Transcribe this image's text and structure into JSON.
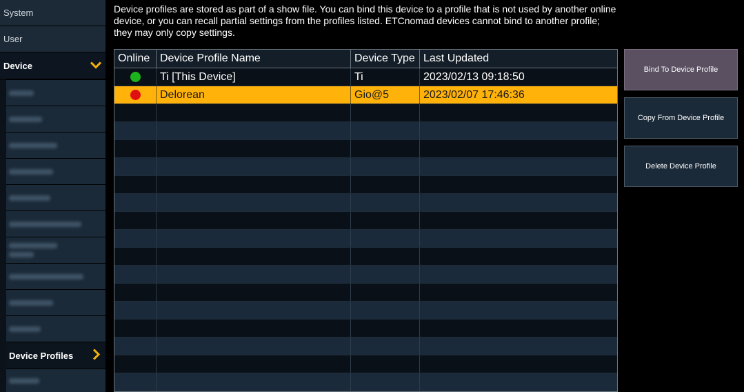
{
  "sidebar": {
    "top_items": [
      {
        "label": "System"
      },
      {
        "label": "User"
      },
      {
        "label": "Device",
        "selected": true
      }
    ],
    "sub_items": [
      {
        "label": ""
      },
      {
        "label": ""
      },
      {
        "label": ""
      },
      {
        "label": ""
      },
      {
        "label": ""
      },
      {
        "label": ""
      },
      {
        "label": ""
      },
      {
        "label": ""
      },
      {
        "label": ""
      },
      {
        "label": ""
      },
      {
        "label": "Device Profiles",
        "selected": true
      },
      {
        "label": ""
      }
    ]
  },
  "description": "Device profiles are stored as part of a show file. You can bind this device to a profile that is not used by another online device, or you can recall partial settings from the profiles listed. ETCnomad devices cannot bind to another profile; they may only copy settings.",
  "table": {
    "columns": [
      "Online",
      "Device Profile Name",
      "Device Type",
      "Last Updated"
    ],
    "rows": [
      {
        "online_status": "online",
        "online_color": "#1db31d",
        "name": "Ti [This Device]",
        "type": "Ti",
        "updated": "2023/02/13 09:18:50",
        "selected": false
      },
      {
        "online_status": "offline",
        "online_color": "#e01010",
        "name": "Delorean",
        "type": "Gio@5",
        "updated": "2023/02/07 17:46:36",
        "selected": true
      }
    ],
    "empty_rows": 16
  },
  "buttons": {
    "bind": "Bind To Device Profile",
    "copy": "Copy From Device Profile",
    "delete": "Delete Device Profile"
  },
  "colors": {
    "accent": "#ffb20a",
    "chevron": "#f5b10c"
  }
}
